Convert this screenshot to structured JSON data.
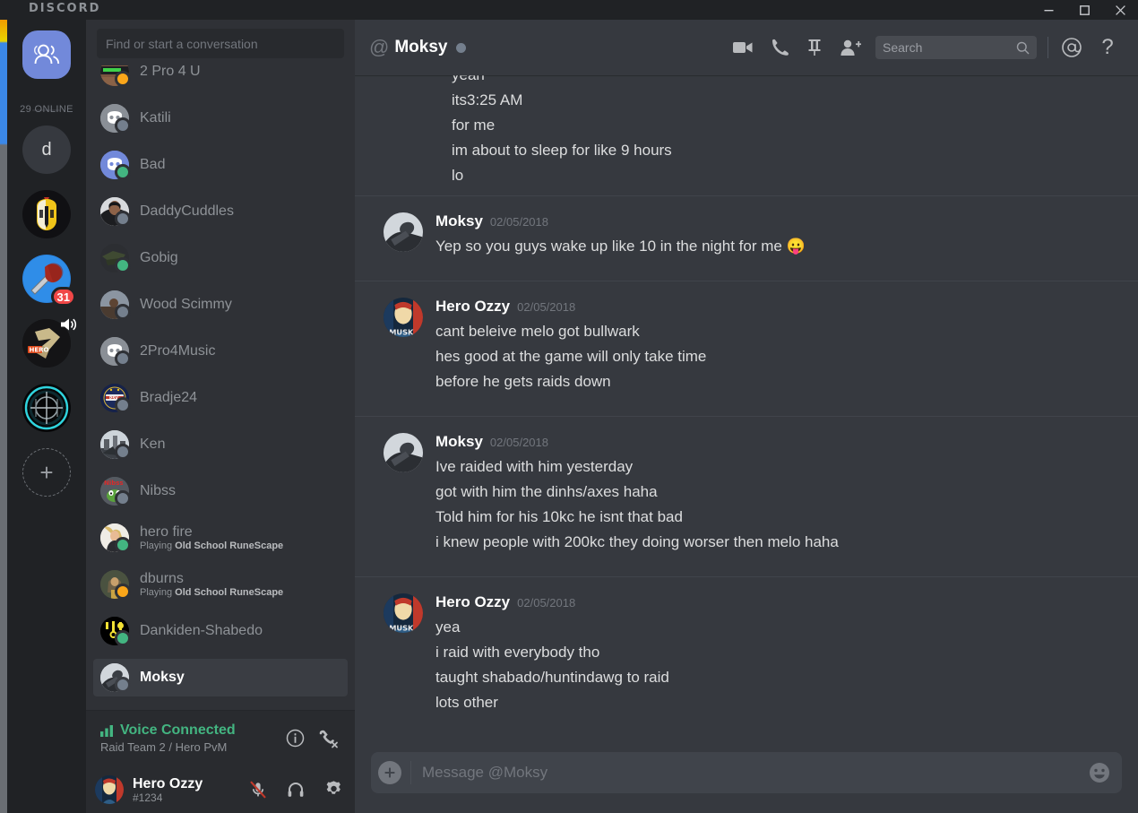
{
  "window": {
    "app_title": "DISCORD",
    "minimize": "minimize",
    "maximize": "maximize",
    "close": "close"
  },
  "guilds": {
    "home_label": "home",
    "online_count": "29 ONLINE",
    "items": [
      {
        "name": "d",
        "type": "initial",
        "badge": null
      },
      {
        "name": "helmet-server",
        "type": "art-helmet",
        "badge": null
      },
      {
        "name": "hammer-server",
        "type": "art-hammer",
        "badge": "31"
      },
      {
        "name": "hero-pvm-server",
        "type": "art-hero",
        "badge": null,
        "speaker": true
      },
      {
        "name": "target-server",
        "type": "art-target",
        "badge": null
      }
    ],
    "add_label": "+"
  },
  "sidebar": {
    "search_placeholder": "Find or start a conversation",
    "dms": [
      {
        "name": "2 Pro 4 U",
        "status": "idle",
        "sub": null,
        "avatar": "art-2pro"
      },
      {
        "name": "Katili",
        "status": "offline",
        "sub": null,
        "avatar": "discord-grey"
      },
      {
        "name": "Bad",
        "status": "online",
        "sub": null,
        "avatar": "discord-blurple"
      },
      {
        "name": "DaddyCuddles",
        "status": "offline",
        "sub": null,
        "avatar": "art-daddy"
      },
      {
        "name": "Gobig",
        "status": "online",
        "sub": null,
        "avatar": "art-gobig"
      },
      {
        "name": "Wood Scimmy",
        "status": "offline",
        "sub": null,
        "avatar": "art-wood"
      },
      {
        "name": "2Pro4Music",
        "status": "offline",
        "sub": null,
        "avatar": "discord-grey"
      },
      {
        "name": "Bradje24",
        "status": "offline",
        "sub": null,
        "avatar": "art-psv"
      },
      {
        "name": "Ken",
        "status": "offline",
        "sub": null,
        "avatar": "art-ken"
      },
      {
        "name": "Nibss",
        "status": "offline",
        "sub": null,
        "avatar": "art-nibss"
      },
      {
        "name": "hero fire",
        "status": "online",
        "sub_prefix": "Playing ",
        "sub_game": "Old School RuneScape",
        "avatar": "art-herofire"
      },
      {
        "name": "dburns",
        "status": "idle",
        "sub_prefix": "Playing ",
        "sub_game": "Old School RuneScape",
        "avatar": "art-dburns"
      },
      {
        "name": "Dankiden-Shabedo",
        "status": "online",
        "sub": null,
        "avatar": "art-dank"
      },
      {
        "name": "Moksy",
        "status": "offline",
        "sub": null,
        "avatar": "art-moksy",
        "active": true
      }
    ],
    "voice": {
      "title": "Voice Connected",
      "channel": "Raid Team 2 / Hero PvM",
      "info_label": "info",
      "disconnect_label": "disconnect"
    },
    "user": {
      "name": "Hero Ozzy",
      "tag": "#1234",
      "mute_label": "mute",
      "deafen_label": "deafen",
      "settings_label": "settings"
    }
  },
  "chat_header": {
    "at": "@",
    "title": "Moksy",
    "status": "offline",
    "icons": {
      "video": "video-call",
      "call": "voice-call",
      "pin": "pinned-messages",
      "add_friend": "add-friend",
      "mentions": "@",
      "help": "?"
    },
    "search_placeholder": "Search"
  },
  "messages": [
    {
      "id": "m0",
      "continuation": true,
      "author": null,
      "timestamp": null,
      "avatar": null,
      "lines": [
        "yeah",
        "its3:25 AM",
        "for me",
        "im about to sleep for like 9 hours",
        "lo"
      ]
    },
    {
      "id": "m1",
      "continuation": false,
      "author": "Moksy",
      "timestamp": "02/05/2018",
      "avatar": "art-moksy",
      "lines": [
        "Yep so you guys wake up like 10 in the night for me 😛"
      ]
    },
    {
      "id": "m2",
      "continuation": false,
      "author": "Hero Ozzy",
      "timestamp": "02/05/2018",
      "avatar": "art-ozzy",
      "lines": [
        "cant beleive melo got bullwark",
        "hes good at the game will only take time",
        "before he gets raids down"
      ]
    },
    {
      "id": "m3",
      "continuation": false,
      "author": "Moksy",
      "timestamp": "02/05/2018",
      "avatar": "art-moksy",
      "lines": [
        "Ive raided with him yesterday",
        "got with him the dinhs/axes haha",
        "Told him for his 10kc he isnt that bad",
        "i knew people with 200kc they doing worser then melo haha"
      ]
    },
    {
      "id": "m4",
      "continuation": false,
      "author": "Hero Ozzy",
      "timestamp": "02/05/2018",
      "avatar": "art-ozzy",
      "lines": [
        "yea",
        "i raid with everybody tho",
        "taught shabado/huntindawg to raid",
        "lots other"
      ]
    }
  ],
  "composer": {
    "add_label": "+",
    "placeholder": "Message @Moksy",
    "emoji_label": "emoji-picker"
  },
  "colors": {
    "accent_blurple": "#7289da",
    "online_green": "#43b581",
    "idle_yellow": "#faa61a",
    "offline_grey": "#747f8d",
    "danger_red": "#f04747",
    "bg_chat": "#36393f",
    "bg_sidebar": "#2f3136",
    "bg_rail": "#202225"
  }
}
